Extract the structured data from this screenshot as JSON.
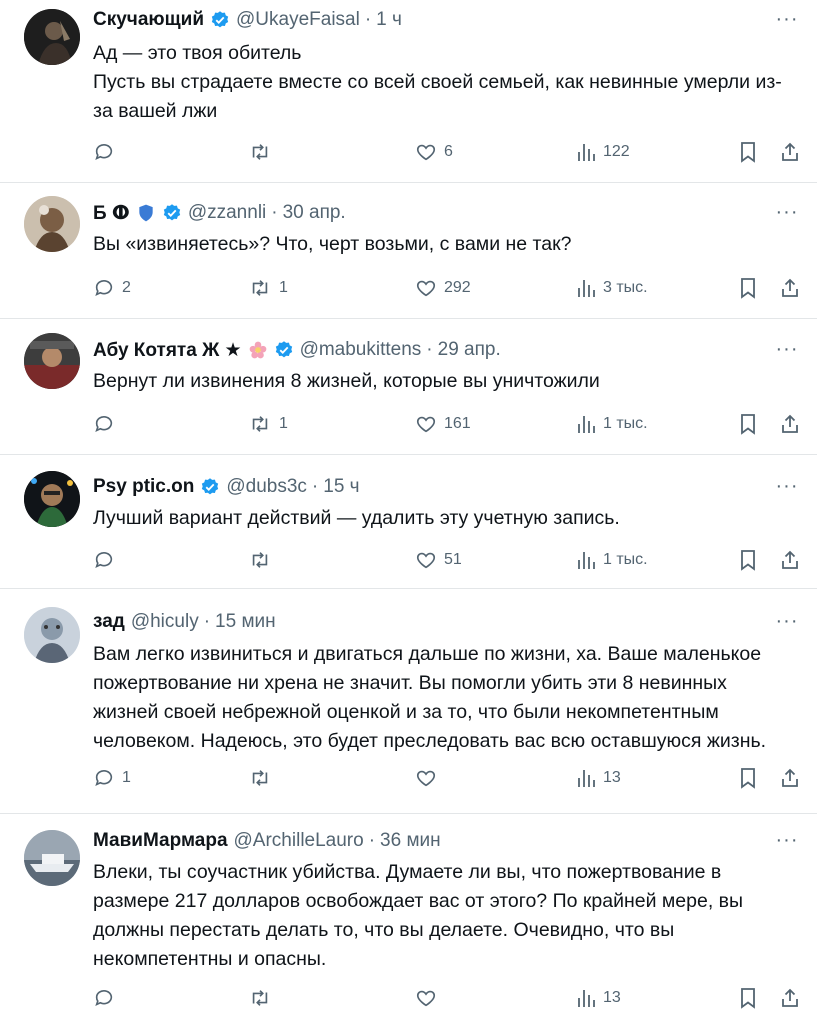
{
  "colors": {
    "verified": "#1d9bf0",
    "text": "#0f1419",
    "secondary": "#536471",
    "divider": "#e3e6e8"
  },
  "tweets": [
    {
      "name": "Скучающий",
      "handle": "@UkayeFaisal",
      "time": "1 ч",
      "verified": true,
      "text_lines": [
        "Ад — это твоя обитель",
        "Пусть вы страдаете вместе со всей своей семьей, как невинные умерли из-",
        "за вашей лжи"
      ],
      "replies": "",
      "retweets": "",
      "likes": "6",
      "views": "122"
    },
    {
      "name": "Б ⵀ",
      "handle": "@zzannli",
      "time": "30 апр.",
      "verified": true,
      "text_lines": [
        "Вы «извиняетесь»? Что, черт возьми, с вами не так?"
      ],
      "replies": "2",
      "retweets": "1",
      "likes": "292",
      "views": "3 тыс."
    },
    {
      "name": "Абу Котята Ж ★",
      "handle": "@mabukittens",
      "time": "29 апр.",
      "verified": true,
      "text_lines": [
        "Вернут ли извинения 8 жизней, которые вы уничтожили"
      ],
      "replies": "",
      "retweets": "1",
      "likes": "161",
      "views": "1 тыс."
    },
    {
      "name": "Psy  ptic.on",
      "handle": "@dubs3c",
      "time": "15 ч",
      "verified": true,
      "text_lines": [
        "Лучший вариант действий — удалить эту учетную запись."
      ],
      "replies": "",
      "retweets": "",
      "likes": "51",
      "views": "1 тыс."
    },
    {
      "name": "зад",
      "handle": "@hiculy",
      "time": "15 мин",
      "verified": false,
      "text_lines": [
        "Вам легко извиниться и двигаться дальше по жизни, ха. Ваше маленькое",
        "пожертвование ни хрена не значит. Вы помогли убить эти 8 невинных",
        "жизней своей небрежной оценкой и за то, что были некомпетентным",
        "человеком. Надеюсь, это будет преследовать вас всю оставшуюся жизнь."
      ],
      "replies": "1",
      "retweets": "",
      "likes": "",
      "views": "13"
    },
    {
      "name": "МавиМармара",
      "handle": "@ArchilleLauro",
      "time": "36 мин",
      "verified": false,
      "text_lines": [
        "Влеки, ты соучастник убийства. Думаете ли вы, что пожертвование в",
        "размере 217 долларов освобождает вас от этого? По крайней мере, вы",
        "должны перестать делать то, что вы делаете. Очевидно, что вы",
        "некомпетентны и опасны."
      ],
      "replies": "",
      "retweets": "",
      "likes": "",
      "views": "13"
    }
  ]
}
